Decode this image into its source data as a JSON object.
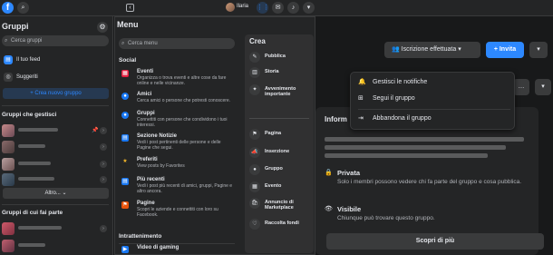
{
  "topbar": {
    "logo": "f",
    "search_icon": "⌕",
    "username": "Ilaria"
  },
  "sidebar": {
    "title": "Gruppi",
    "search_placeholder": "Cerca gruppi",
    "nav": [
      {
        "label": "Il tuo feed",
        "icon": "feed-icon"
      },
      {
        "label": "Suggeriti",
        "icon": "compass-icon"
      }
    ],
    "create_button": "+ Crea nuovo gruppo",
    "managed_section": "Gruppi che gestisci",
    "more_button": "Altro... ⌄",
    "member_section": "Gruppi di cui fai parte"
  },
  "menu": {
    "title": "Menu",
    "search_placeholder": "Cerca menu",
    "social_section": "Social",
    "items": [
      {
        "title": "Eventi",
        "desc": "Organizza o trova eventi e altre cose da fare online e nelle vicinanze.",
        "icon": "calendar-icon",
        "color": "#e41e3f"
      },
      {
        "title": "Amici",
        "desc": "Cerca amici o persone che potresti conoscere.",
        "icon": "friends-icon",
        "color": "#1877f2"
      },
      {
        "title": "Gruppi",
        "desc": "Connettiti con persone che condividono i tuoi interessi.",
        "icon": "groups-icon",
        "color": "#1877f2"
      },
      {
        "title": "Sezione Notizie",
        "desc": "Vedi i post pertinenti delle persone e delle Pagine che segui.",
        "icon": "news-icon",
        "color": "#1877f2"
      },
      {
        "title": "Preferiti",
        "desc": "View posts by Favorites",
        "icon": "star-icon",
        "color": "#f7b928"
      },
      {
        "title": "Più recenti",
        "desc": "Vedi i post più recenti di amici, gruppi, Pagine e altro ancora.",
        "icon": "clock-icon",
        "color": "#1877f2"
      },
      {
        "title": "Pagine",
        "desc": "Scopri le aziende e connettiti con loro su Facebook.",
        "icon": "flag-icon",
        "color": "#e8540c"
      }
    ],
    "entertainment_section": "Intrattenimento",
    "entertainment_items": [
      {
        "title": "Video di gaming",
        "icon": "gaming-icon",
        "color": "#1877f2"
      }
    ]
  },
  "crea": {
    "title": "Crea",
    "items": [
      {
        "label": "Pubblica",
        "icon": "edit-icon"
      },
      {
        "label": "Storia",
        "icon": "book-icon"
      },
      {
        "label": "Avvenimento importante",
        "icon": "star-icon"
      },
      {
        "label": "Pagina",
        "icon": "flag-icon"
      },
      {
        "label": "Inserzione",
        "icon": "megaphone-icon"
      },
      {
        "label": "Gruppo",
        "icon": "groups-icon"
      },
      {
        "label": "Evento",
        "icon": "calendar-icon"
      },
      {
        "label": "Annuncio di Marketplace",
        "icon": "bag-icon"
      },
      {
        "label": "Raccolta fondi",
        "icon": "heart-icon"
      }
    ]
  },
  "group_actions": {
    "joined_label": "Iscrizione effettuata",
    "invite_label": "+ Invita"
  },
  "dropdown": {
    "items": [
      {
        "label": "Gestisci le notifiche",
        "icon": "bell-icon"
      },
      {
        "label": "Segui il gruppo",
        "icon": "follow-icon"
      },
      {
        "label": "Abbandona il gruppo",
        "icon": "leave-icon"
      }
    ]
  },
  "info": {
    "title": "Inform",
    "private_title": "Privata",
    "private_desc": "Solo i membri possono vedere chi fa parte del gruppo e cosa pubblica.",
    "visible_title": "Visibile",
    "visible_desc": "Chiunque può trovare questo gruppo.",
    "more_button": "Scopri di più"
  },
  "colors": {
    "accent": "#2d88ff",
    "background": "#18191a",
    "surface": "#242526"
  }
}
